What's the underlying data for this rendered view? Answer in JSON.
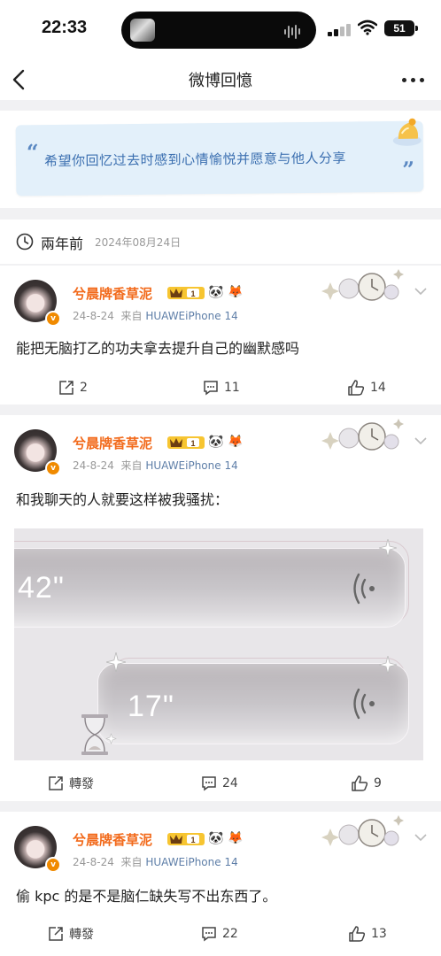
{
  "status_bar": {
    "time": "22:33",
    "battery": "51"
  },
  "nav": {
    "title": "微博回憶"
  },
  "banner": {
    "open_quote": "“",
    "close_quote": "”",
    "text": "希望你回忆过去时感到心情愉悦并愿意与他人分享"
  },
  "section": {
    "label": "兩年前",
    "date": "2024年08月24日"
  },
  "posts": [
    {
      "username": "兮晨牌香草泥",
      "date": "24-8-24",
      "source_prefix": "来自",
      "source": "HUAWEiPhone 14",
      "text": "能把无脑打乙的功夫拿去提升自己的幽默感吗",
      "repost": "2",
      "comments": "11",
      "likes": "14"
    },
    {
      "username": "兮晨牌香草泥",
      "date": "24-8-24",
      "source_prefix": "来自",
      "source": "HUAWEiPhone 14",
      "text": "和我聊天的人就要这样被我骚扰：",
      "media": {
        "voice1": "42\"",
        "voice2": "17\""
      },
      "repost": "轉發",
      "comments": "24",
      "likes": "9"
    },
    {
      "username": "兮晨牌香草泥",
      "date": "24-8-24",
      "source_prefix": "来自",
      "source": "HUAWEiPhone 14",
      "text": "偷 kpc 的是不是脑仁缺失写不出东西了。",
      "repost": "轉發",
      "comments": "22",
      "likes": "13"
    }
  ],
  "badge_level": "1",
  "icons": [
    "back-icon",
    "more-icon",
    "clock-icon",
    "share-icon",
    "comment-icon",
    "like-icon",
    "chevron-down-icon",
    "vip-crown-icon"
  ]
}
